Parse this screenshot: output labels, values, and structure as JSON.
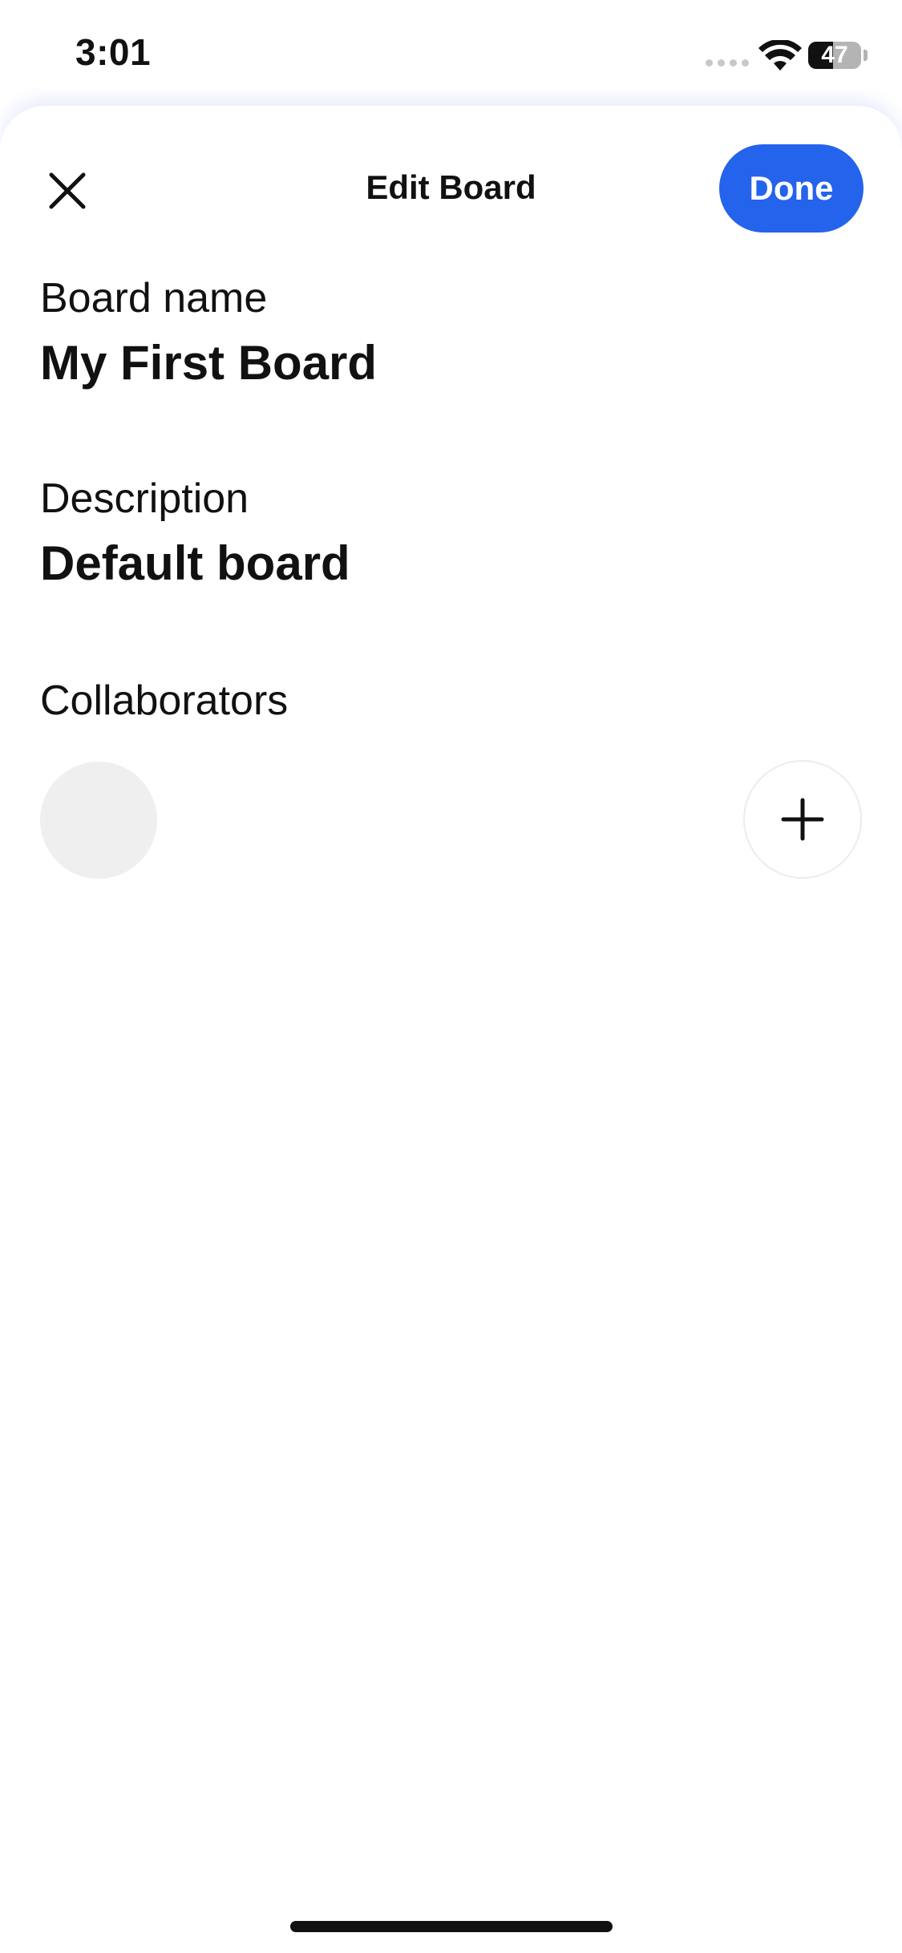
{
  "status_bar": {
    "time": "3:01",
    "battery_level": "47",
    "battery_fraction": 0.47,
    "icons": [
      "cellular-signal-icon",
      "wifi-icon",
      "battery-icon"
    ]
  },
  "header": {
    "title": "Edit Board",
    "done_label": "Done",
    "close_icon": "close-icon",
    "accent_color": "#2463eb"
  },
  "fields": {
    "board_name": {
      "label": "Board name",
      "value": "My First Board"
    },
    "description": {
      "label": "Description",
      "value": "Default board"
    }
  },
  "collaborators": {
    "label": "Collaborators",
    "avatar_color": "#efefef",
    "add_icon": "plus-icon"
  }
}
